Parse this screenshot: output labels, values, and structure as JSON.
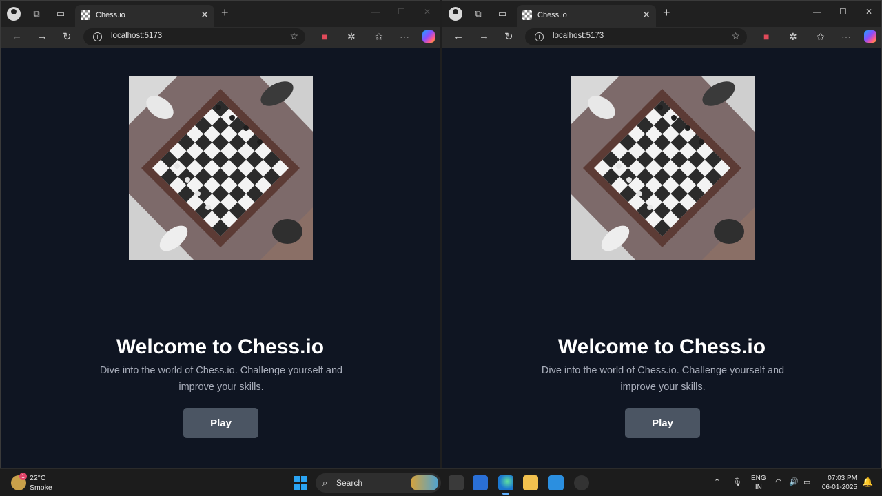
{
  "windows": [
    {
      "tab_title": "Chess.io",
      "url": "localhost:5173",
      "welcome": "Welcome to Chess.io",
      "description": "Dive into the world of Chess.io. Challenge yourself and improve your skills.",
      "play_label": "Play"
    },
    {
      "tab_title": "Chess.io",
      "url": "localhost:5173",
      "welcome": "Welcome to Chess.io",
      "description": "Dive into the world of Chess.io. Challenge yourself and improve your skills.",
      "play_label": "Play"
    }
  ],
  "taskbar": {
    "weather_temp": "22°C",
    "weather_condition": "Smoke",
    "weather_badge": "1",
    "search_label": "Search",
    "lang_line1": "ENG",
    "lang_line2": "IN",
    "time": "07:03 PM",
    "date": "06-01-2025"
  },
  "colors": {
    "page_bg": "#0f1522",
    "button_bg": "#4b5563",
    "accent": "#2aa4f4"
  }
}
